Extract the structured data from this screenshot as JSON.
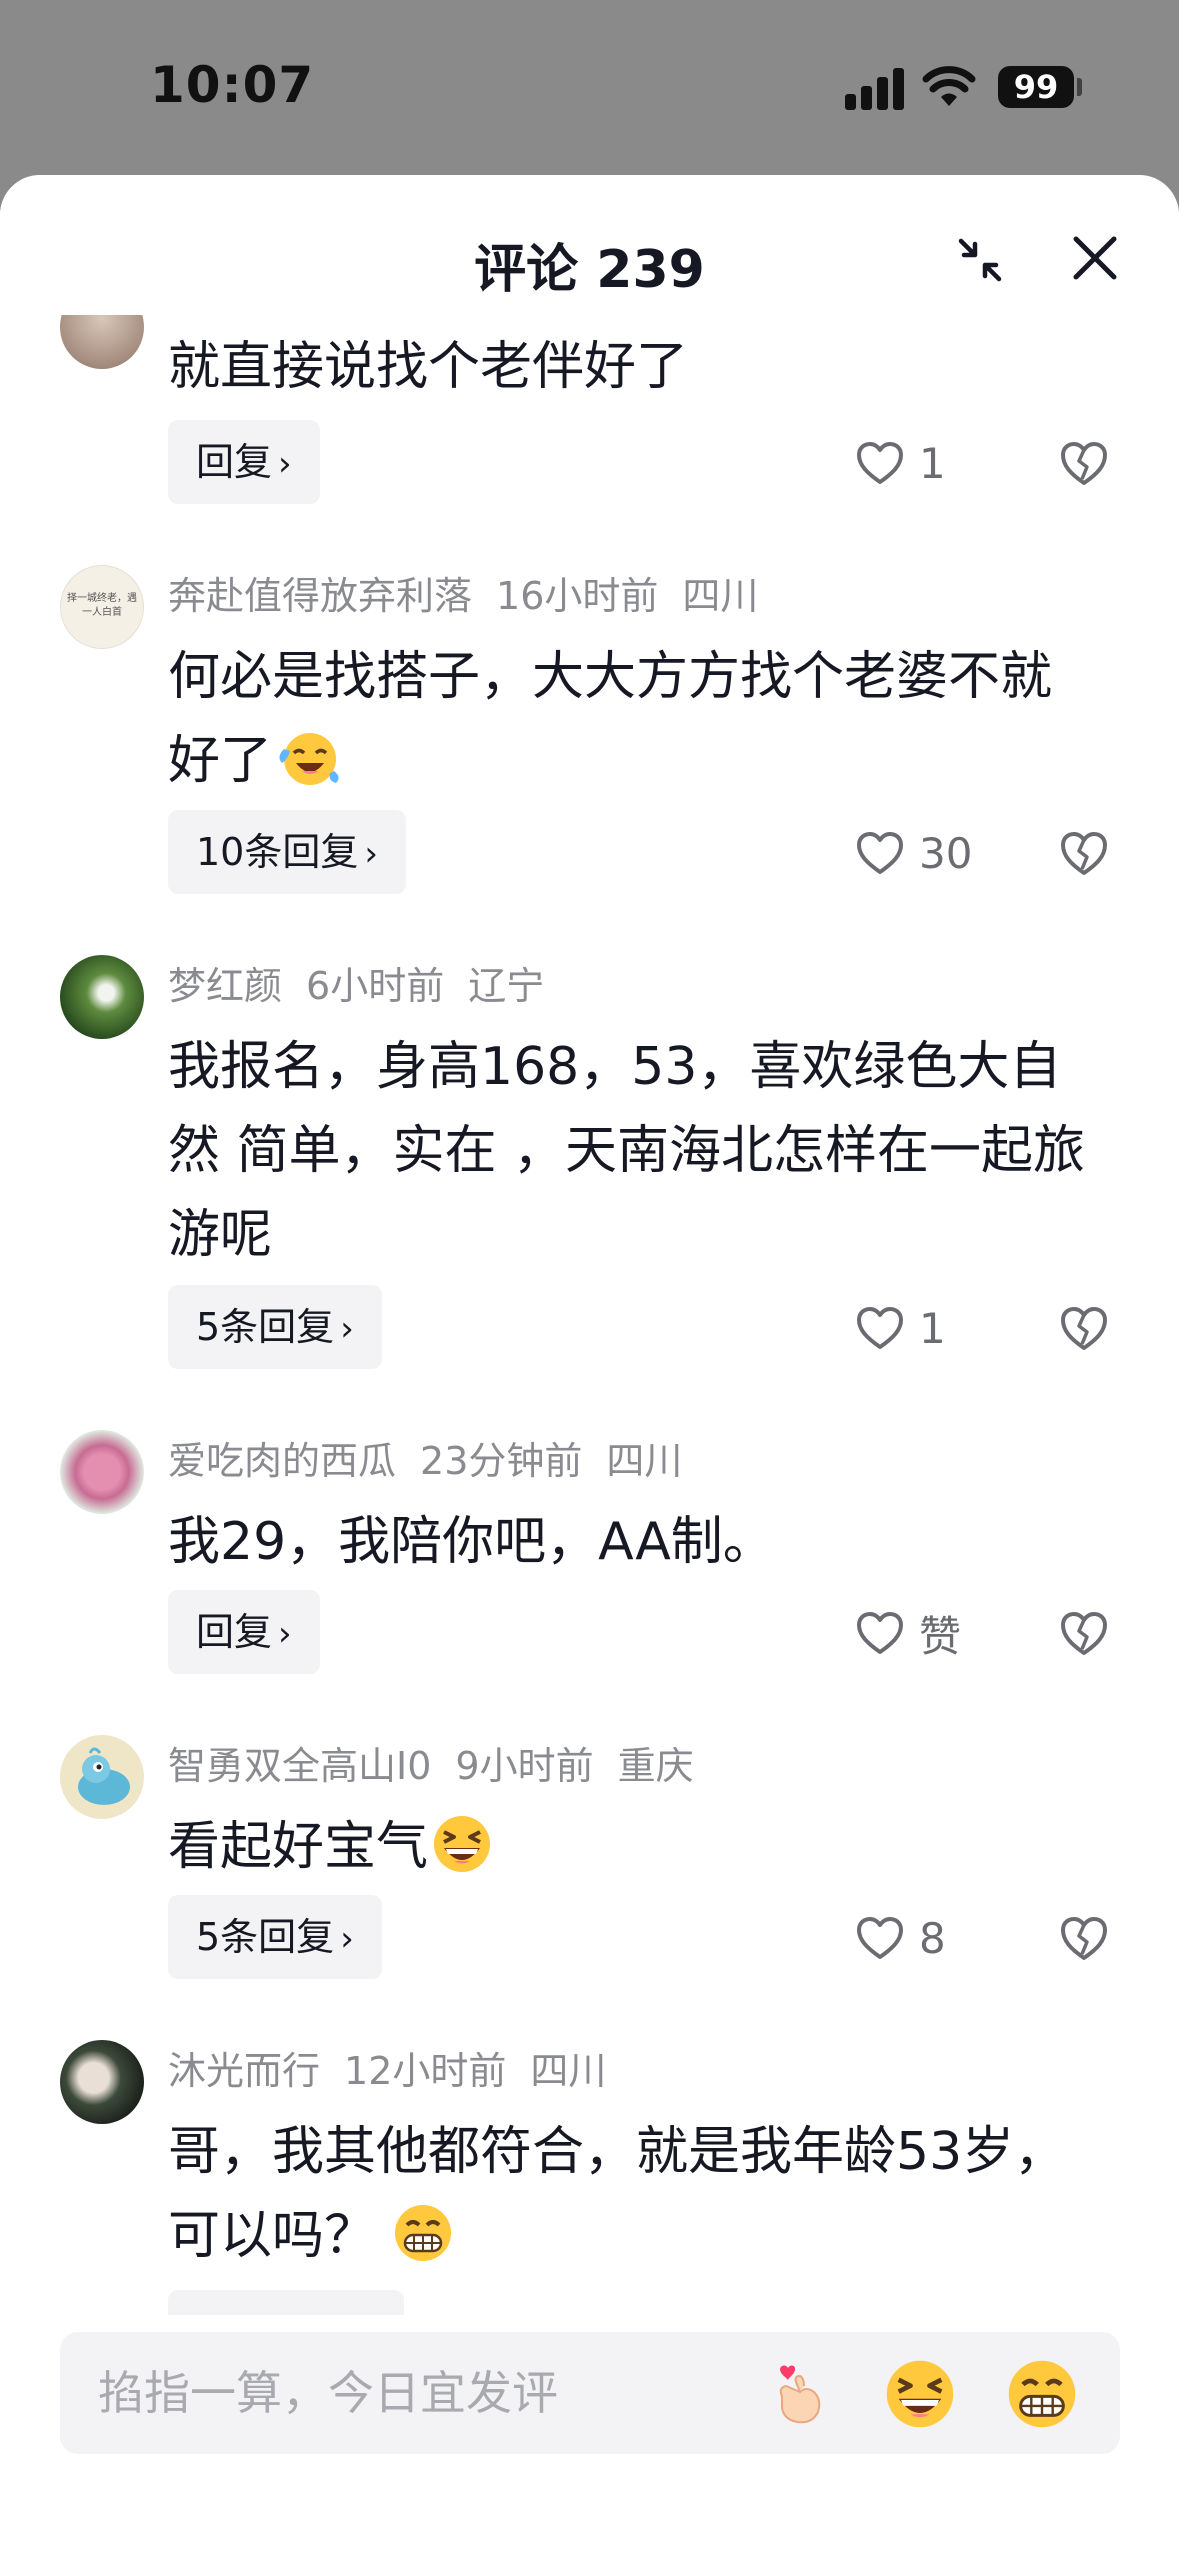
{
  "status": {
    "time": "10:07",
    "battery": "99"
  },
  "sheet": {
    "title": "评论 239"
  },
  "comments": [
    {
      "text": "就直接说找个老伴好了",
      "reply": "回复",
      "likes": "1"
    },
    {
      "user": "奔赴值得放弃利落",
      "time": "16小时前",
      "location": "四川",
      "avatar_text": "择一城终老，遇一人白首",
      "text": "何必是找搭子，大大方方找个老婆不就好了",
      "emoji": "laughing-crying-emoji",
      "reply": "10条回复",
      "likes": "30"
    },
    {
      "user": "梦红颜",
      "time": "6小时前",
      "location": "辽宁",
      "text": "我报名，身高168，53，喜欢绿色大自然 简单，实在 ，天南海北怎样在一起旅游呢",
      "reply": "5条回复",
      "likes": "1"
    },
    {
      "user": "爱吃肉的西瓜",
      "time": "23分钟前",
      "location": "四川",
      "text": "我29，我陪你吧，AA制。",
      "reply": "回复",
      "likes": "赞"
    },
    {
      "user": "智勇双全高山I0",
      "time": "9小时前",
      "location": "重庆",
      "text": "看起好宝气",
      "emoji": "grinning-squint-emoji",
      "reply": "5条回复",
      "likes": "8"
    },
    {
      "user": "沐光而行",
      "time": "12小时前",
      "location": "四川",
      "text": "哥，我其他都符合，就是我年龄53岁，可以吗？",
      "emoji": "grinning-teeth-emoji"
    }
  ],
  "input": {
    "placeholder": "掐指一算，今日宜发评",
    "quick_emojis": [
      "finger-heart-emoji",
      "grinning-squint-emoji",
      "grinning-teeth-emoji"
    ]
  },
  "colors": {
    "background": "#8a8a8a",
    "sheet": "#ffffff",
    "text": "#161823",
    "meta": "#8a8b91",
    "chip": "#f3f3f5"
  }
}
